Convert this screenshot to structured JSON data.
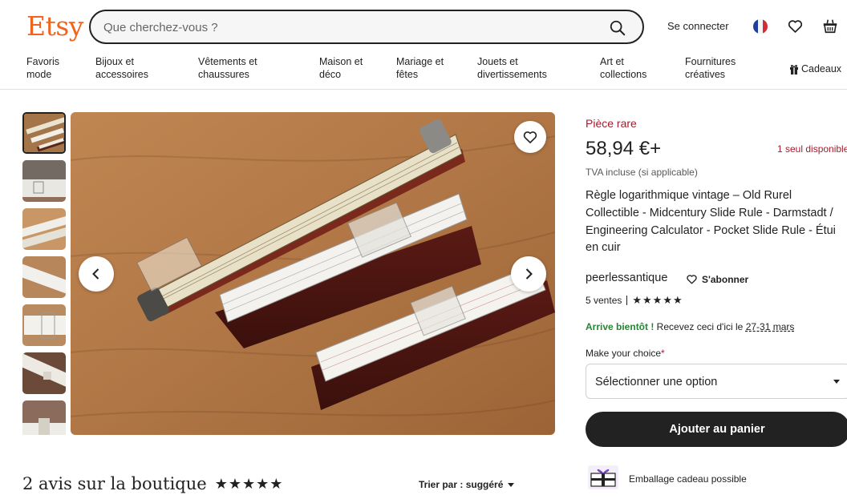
{
  "header": {
    "logo": "Etsy",
    "search_placeholder": "Que cherchez-vous ?",
    "signin": "Se connecter",
    "colors": {
      "brand": "#f1641e",
      "accent_red": "#a61a2e",
      "green": "#258635"
    }
  },
  "nav": {
    "items": [
      {
        "line1": "Favoris",
        "line2": "mode"
      },
      {
        "line1": "Bijoux et",
        "line2": "accessoires"
      },
      {
        "line1": "Vêtements et",
        "line2": "chaussures"
      },
      {
        "line1": "Maison et",
        "line2": "déco"
      },
      {
        "line1": "Mariage et",
        "line2": "fêtes"
      },
      {
        "line1": "Jouets et",
        "line2": "divertissements"
      },
      {
        "line1": "Art et",
        "line2": "collections"
      },
      {
        "line1": "Fournitures",
        "line2": "créatives"
      }
    ],
    "gifts": "Cadeaux"
  },
  "listing": {
    "badge": "Pièce rare",
    "price": "58,94 €+",
    "stock": "1 seul disponible",
    "vat": "TVA incluse (si applicable)",
    "title": "Règle logarithmique vintage – Old Rurel Collectible - Midcentury Slide Rule - Darmstadt / Engineering Calculator - Pocket Slide Rule - Étui en cuir",
    "shop_name": "peerlessantique",
    "follow": "S'abonner",
    "sales": "5 ventes",
    "rating_stars": "★★★★★",
    "delivery_status": "Arrive bientôt !",
    "delivery_text": " Recevez ceci d'ici le ",
    "delivery_dates": "27-31 mars",
    "choice_label": "Make your choice",
    "choice_required": "*",
    "select_value": "Sélectionner une option",
    "add_to_cart": "Ajouter au panier",
    "gift_wrap": "Emballage cadeau possible"
  },
  "reviews": {
    "title": "2 avis sur la boutique",
    "stars": "★★★★★",
    "sort_label": "Trier par : suggéré"
  },
  "icons": [
    "search-icon",
    "flag-fr-icon",
    "heart-icon",
    "basket-icon",
    "gift-icon",
    "chevron-left-icon",
    "chevron-right-icon"
  ]
}
